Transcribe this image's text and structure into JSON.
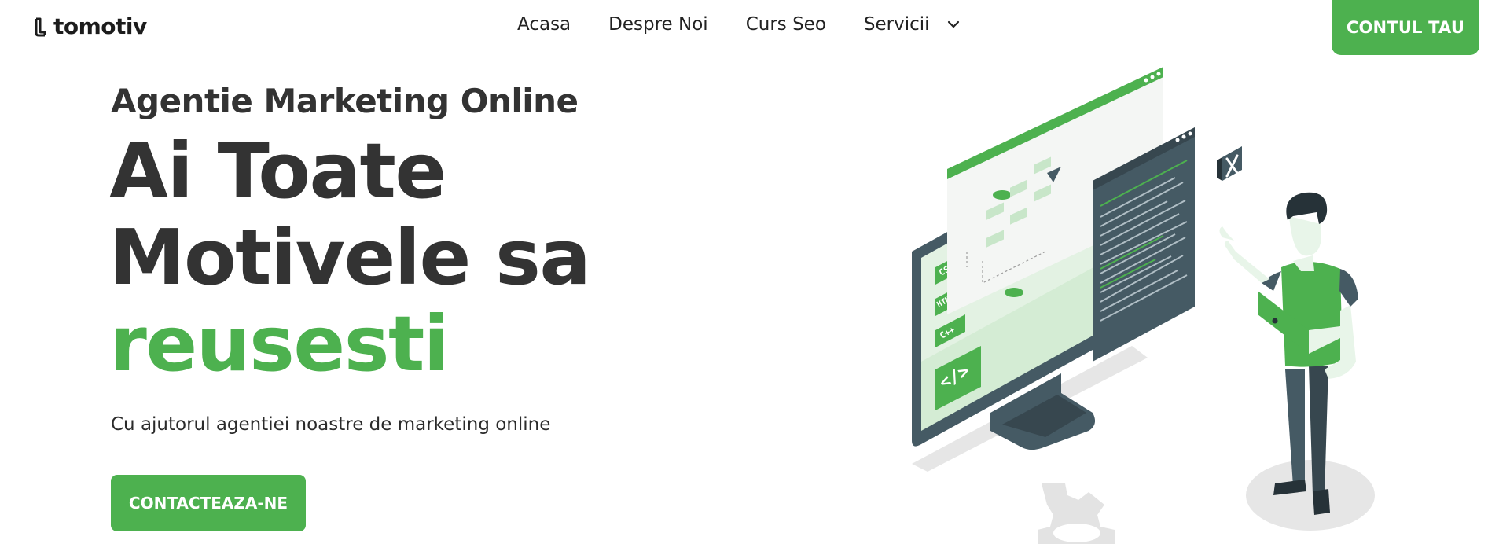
{
  "brand": {
    "name": "tomotiv",
    "logo_icon": "tomotiv-logo-icon"
  },
  "nav": {
    "items": [
      {
        "label": "Acasa"
      },
      {
        "label": "Despre Noi"
      },
      {
        "label": "Curs Seo"
      },
      {
        "label": "Servicii"
      }
    ],
    "dropdown_icon": "chevron-down-icon",
    "account_button": "CONTUL TAU"
  },
  "hero": {
    "subtitle": "Agentie Marketing Online",
    "headline_line1": "Ai Toate",
    "headline_line2": "Motivele sa",
    "headline_line3": "reusesti",
    "description": "Cu ajutorul agentiei noastre de marketing online",
    "cta": "CONTACTEAZA-NE"
  },
  "illustration": {
    "tags": [
      "CSS",
      "HTML",
      "C++"
    ],
    "code_icon_label": "</>"
  },
  "colors": {
    "accent": "#4db14f",
    "text_dark": "#333333",
    "illustration_dark": "#455a64",
    "illustration_light": "#d4ecd4"
  }
}
